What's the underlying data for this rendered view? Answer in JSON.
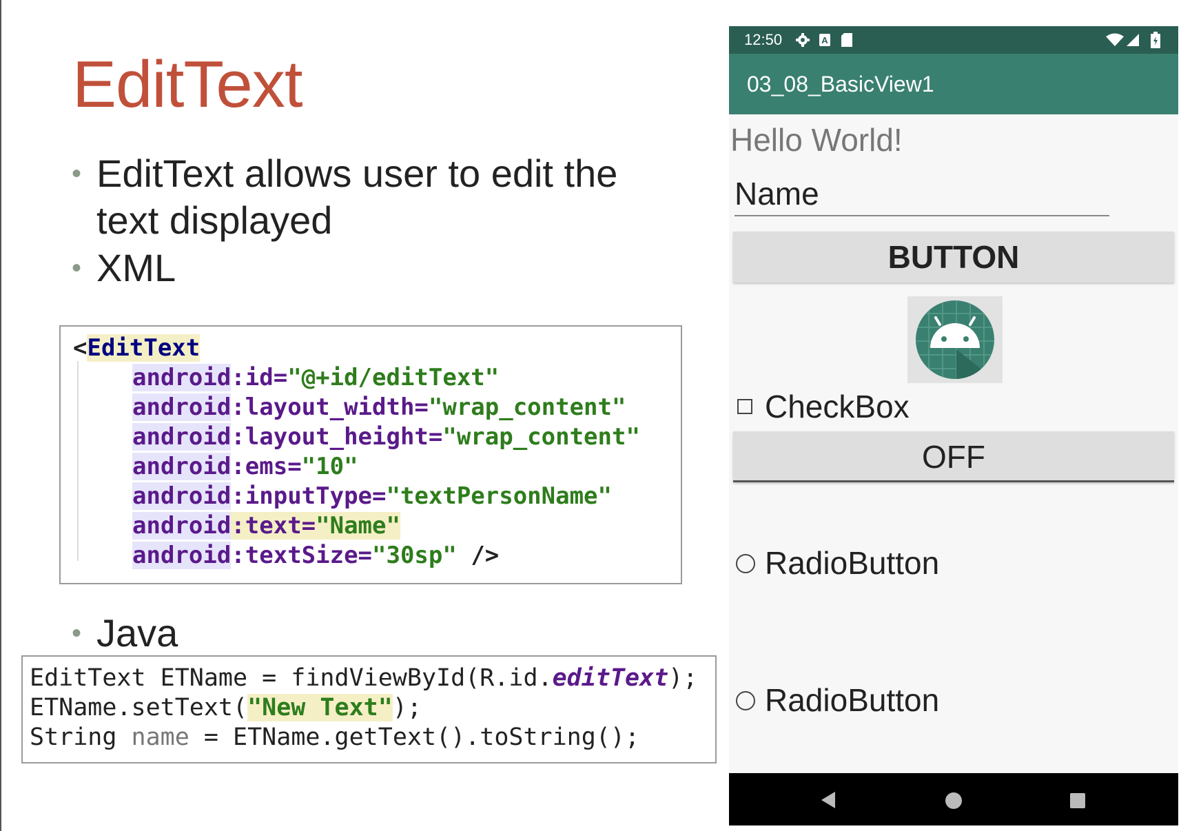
{
  "slide": {
    "title": "EditText",
    "bullets": {
      "b1_line1": "EditText allows user to edit the",
      "b1_line2": "text displayed",
      "b2": "XML",
      "b3": "Java",
      "dot": "•"
    }
  },
  "xml_code": {
    "l1_open": "<",
    "l1_tag": "EditText",
    "prefix": "android",
    "colon": ":",
    "l2_attr": "id=",
    "l2_val": "\"@+id/editText\"",
    "l3_attr": "layout_width=",
    "l3_val": "\"wrap_content\"",
    "l4_attr": "layout_height=",
    "l4_val": "\"wrap_content\"",
    "l5_attr": "ems=",
    "l5_val": "\"10\"",
    "l6_attr": "inputType=",
    "l6_val": "\"textPersonName\"",
    "l7_attr": "text=",
    "l7_val": "\"Name\"",
    "l8_attr": "textSize=",
    "l8_val": "\"30sp\"",
    "l8_close": " />"
  },
  "java_code": {
    "l1_a": "EditText ETName = findViewById(R.id.",
    "l1_b": "editText",
    "l1_c": ");",
    "l2_a": "ETName.setText(",
    "l2_b": "\"New Text\"",
    "l2_c": ");",
    "l3_a": "String ",
    "l3_b": "name",
    "l3_c": " = ETName.getText().toString();"
  },
  "phone": {
    "status": {
      "time": "12:50",
      "icons": [
        "gear-icon",
        "a-notification-icon",
        "sd-card-icon",
        "wifi-icon",
        "signal-icon",
        "battery-icon"
      ]
    },
    "app_title": "03_08_BasicView1",
    "hello_text": "Hello World!",
    "edit_text_value": "Name",
    "button_label": "BUTTON",
    "checkbox_label": "CheckBox",
    "toggle_label": "OFF",
    "radio1_label": "RadioButton",
    "radio2_label": "RadioButton",
    "nav": [
      "back-icon",
      "home-icon",
      "recents-icon"
    ]
  },
  "colors": {
    "title": "#c0503a",
    "status_bar": "#2a5e52",
    "app_bar": "#3a8070",
    "android_icon_bg": "#3a8070"
  }
}
